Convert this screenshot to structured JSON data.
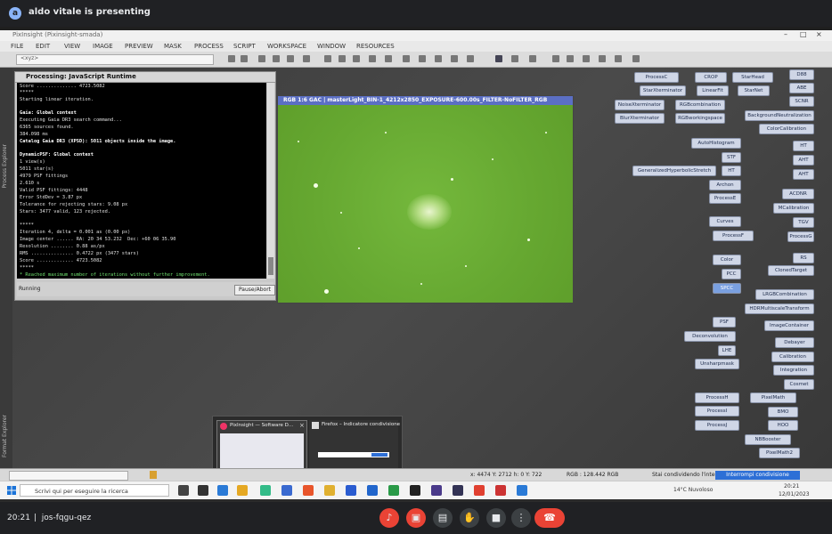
{
  "meet": {
    "presenter_initial": "a",
    "presenting_text": "aldo vitale is presenting",
    "clock": "20:21",
    "meeting_code": "jos-fqgu-qez"
  },
  "app": {
    "title": "PixInsight (Pixinsight-smada)",
    "menu": [
      "FILE",
      "EDIT",
      "VIEW",
      "IMAGE",
      "PREVIEW",
      "MASK",
      "PROCESS",
      "SCRIPT",
      "WORKSPACE",
      "WINDOW",
      "RESOURCES"
    ],
    "toolbar_combo": "<xyz>"
  },
  "console": {
    "title": "Processing: JavaScript Runtime",
    "lines": [
      {
        "t": "Score .............. 4723.5082",
        "s": ""
      },
      {
        "t": "*****",
        "s": ""
      },
      {
        "t": "Starting linear iteration.",
        "s": ""
      },
      {
        "t": "",
        "s": ""
      },
      {
        "t": "Gaia: Global context",
        "s": "b"
      },
      {
        "t": "Executing Gaia DR3 search command...",
        "s": ""
      },
      {
        "t": "6365 sources found.",
        "s": ""
      },
      {
        "t": "384.098 ms",
        "s": ""
      },
      {
        "t": "Catalog Gaia DR3 (XPSD): 5011 objects inside the image.",
        "s": "b"
      },
      {
        "t": "",
        "s": ""
      },
      {
        "t": "DynamicPSF: Global context",
        "s": "b"
      },
      {
        "t": "1 view(s)",
        "s": ""
      },
      {
        "t": "5011 star(s)",
        "s": ""
      },
      {
        "t": "4979 PSF fittings",
        "s": ""
      },
      {
        "t": "2.610 s",
        "s": ""
      },
      {
        "t": "Valid PSF fittings: 4448",
        "s": ""
      },
      {
        "t": "Error StdDev = 3.87 px",
        "s": ""
      },
      {
        "t": "Tolerance for rejecting stars: 9.08 px",
        "s": ""
      },
      {
        "t": "Stars: 3477 valid, 123 rejected.",
        "s": ""
      },
      {
        "t": "",
        "s": ""
      },
      {
        "t": "*****",
        "s": ""
      },
      {
        "t": "Iteration 4, delta = 0.001 as (0.00 px)",
        "s": ""
      },
      {
        "t": "Image center ...... RA: 20 34 53.232  Dec: +60 06 35.90",
        "s": ""
      },
      {
        "t": "Resolution ........ 0.88 as/px",
        "s": ""
      },
      {
        "t": "RMS ............... 0.4722 px (3477 stars)",
        "s": ""
      },
      {
        "t": "Score ............. 4723.5082",
        "s": ""
      },
      {
        "t": "*****",
        "s": ""
      },
      {
        "t": "* Reached maximum number of iterations without further improvement.",
        "s": "g"
      }
    ],
    "status": "Running",
    "pause_button": "Pause/Abort"
  },
  "image_window": {
    "title": "RGB 1:6 GAC | masterLight_BIN-1_4212x2850_EXPOSURE-600.00s_FILTER-NoFILTER_RGB"
  },
  "process_icons": [
    {
      "label": "ProcessC"
    },
    {
      "label": "CROP"
    },
    {
      "label": "StarHead"
    },
    {
      "label": "D88"
    },
    {
      "label": "StarXterminator"
    },
    {
      "label": "LinearFit"
    },
    {
      "label": "StarNet"
    },
    {
      "label": "ABE"
    },
    {
      "label": "NoiseXterminator"
    },
    {
      "label": "RGBcombination"
    },
    {
      "label": "SCNR"
    },
    {
      "label": "BlurXterminator"
    },
    {
      "label": "RGBworkingspace"
    },
    {
      "label": "BackgroundNeutralization"
    },
    {
      "label": "ColorCalibration"
    },
    {
      "label": "AutoHistogram"
    },
    {
      "label": "HT"
    },
    {
      "label": "STF"
    },
    {
      "label": "AHT"
    },
    {
      "label": "GeneralizedHyperbolicStretch"
    },
    {
      "label": "HT"
    },
    {
      "label": "AHT"
    },
    {
      "label": "Archon"
    },
    {
      "label": "ACDNR"
    },
    {
      "label": "ProcessE"
    },
    {
      "label": "MCalibration"
    },
    {
      "label": "Curves"
    },
    {
      "label": "TGV"
    },
    {
      "label": "ProcessF"
    },
    {
      "label": "ProcessG"
    },
    {
      "label": "Color"
    },
    {
      "label": "RS"
    },
    {
      "label": "PCC"
    },
    {
      "label": "ClonedTarget"
    },
    {
      "label": "SPCC"
    },
    {
      "label": "LRGBCombination"
    },
    {
      "label": "HDRMultiscaleTransform"
    },
    {
      "label": "PSF"
    },
    {
      "label": "ImageContainer"
    },
    {
      "label": "Deconvolution"
    },
    {
      "label": "Debayer"
    },
    {
      "label": "LHE"
    },
    {
      "label": "Calibration"
    },
    {
      "label": "Unsharpmask"
    },
    {
      "label": "Integration"
    },
    {
      "label": "Cosmet"
    },
    {
      "label": "ProcessH"
    },
    {
      "label": "PixelMath"
    },
    {
      "label": "ProcessI"
    },
    {
      "label": "BMO"
    },
    {
      "label": "ProcessJ"
    },
    {
      "label": "HOO"
    },
    {
      "label": "NBBooster"
    },
    {
      "label": "PixelMath2"
    }
  ],
  "thumbnails": {
    "first": "PixInsight — Software D...",
    "second": "Firefox – Indicatore condivisione"
  },
  "pi_status": {
    "coords": "x: 4474   Y: 2712   h: 0   Y: 722",
    "pixel": "RGB  :  128.442 RGB",
    "sharing": "Stai condividendo l'intero schermo.",
    "stop_button": "Interrompi condivisione"
  },
  "taskbar": {
    "search_placeholder": "Scrivi qui per eseguire la ricerca",
    "weather": "14°C  Nuvoloso",
    "time": "20:21",
    "date": "12/01/2023"
  }
}
